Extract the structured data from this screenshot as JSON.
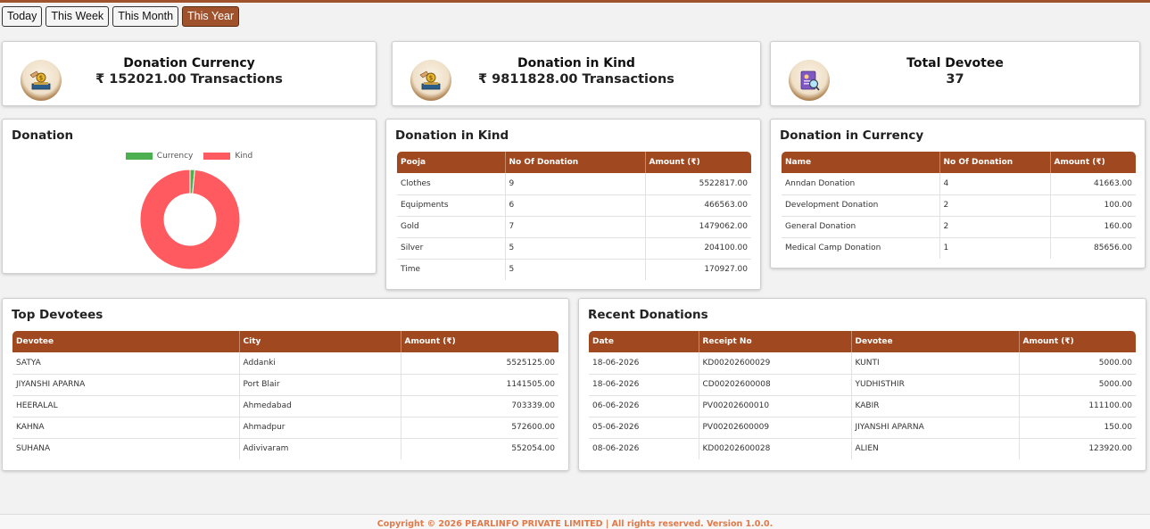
{
  "filters": {
    "today": "Today",
    "this_week": "This Week",
    "this_month": "This Month",
    "this_year": "This Year",
    "active": "This Year"
  },
  "stats": {
    "donation_currency": {
      "title": "Donation Currency",
      "value": "₹ 152021.00 Transactions"
    },
    "donation_kind": {
      "title": "Donation in Kind",
      "value": "₹ 9811828.00 Transactions"
    },
    "total_devotee": {
      "title": "Total Devotee",
      "value": "37"
    }
  },
  "donation_chart": {
    "title": "Donation",
    "chart_data": {
      "type": "pie",
      "donut": true,
      "categories": [
        "Currency",
        "Kind"
      ],
      "values": [
        152021.0,
        9811828.0
      ],
      "colors": [
        "#4caf50",
        "#ff5a5f"
      ],
      "legend": "top"
    }
  },
  "kind_table": {
    "title": "Donation in Kind",
    "headers": [
      "Pooja",
      "No Of Donation",
      "Amount (₹)"
    ],
    "rows": [
      [
        "Clothes",
        "9",
        "5522817.00"
      ],
      [
        "Equipments",
        "6",
        "466563.00"
      ],
      [
        "Gold",
        "7",
        "1479062.00"
      ],
      [
        "Silver",
        "5",
        "204100.00"
      ],
      [
        "Time",
        "5",
        "170927.00"
      ]
    ]
  },
  "currency_table": {
    "title": "Donation in Currency",
    "headers": [
      "Name",
      "No Of Donation",
      "Amount (₹)"
    ],
    "rows": [
      [
        "Anndan Donation",
        "4",
        "41663.00"
      ],
      [
        "Development Donation",
        "2",
        "100.00"
      ],
      [
        "General Donation",
        "2",
        "160.00"
      ],
      [
        "Medical Camp Donation",
        "1",
        "85656.00"
      ]
    ]
  },
  "top_devotees": {
    "title": "Top Devotees",
    "headers": [
      "Devotee",
      "City",
      "Amount (₹)"
    ],
    "rows": [
      [
        "SATYA",
        "Addanki",
        "5525125.00"
      ],
      [
        "JIYANSHI APARNA",
        "Port Blair",
        "1141505.00"
      ],
      [
        "HEERALAL",
        "Ahmedabad",
        "703339.00"
      ],
      [
        "KAHNA",
        "Ahmadpur",
        "572600.00"
      ],
      [
        "SUHANA",
        "Adivivaram",
        "552054.00"
      ]
    ]
  },
  "recent_donations": {
    "title": "Recent Donations",
    "headers": [
      "Date",
      "Receipt No",
      "Devotee",
      "Amount (₹)"
    ],
    "rows": [
      [
        "18-06-2026",
        "KD00202600029",
        "KUNTI",
        "5000.00"
      ],
      [
        "18-06-2026",
        "CD00202600008",
        "YUDHISTHIR",
        "5000.00"
      ],
      [
        "06-06-2026",
        "PV00202600010",
        "KABIR",
        "111100.00"
      ],
      [
        "05-06-2026",
        "PV00202600009",
        "JIYANSHI APARNA",
        "150.00"
      ],
      [
        "08-06-2026",
        "KD00202600028",
        "ALIEN",
        "123920.00"
      ]
    ]
  },
  "footer": {
    "text": "Copyright © 2026 PEARLINFO PRIVATE LIMITED | All rights reserved. Version 1.0.0."
  },
  "icons": {
    "donation_currency": "donation-box-icon",
    "donation_kind": "donation-box-icon",
    "total_devotee": "devotee-id-card-icon"
  },
  "colors": {
    "brand": "#a0481f",
    "active_filter": "#a0522d",
    "footer_text": "#e07a4a"
  }
}
